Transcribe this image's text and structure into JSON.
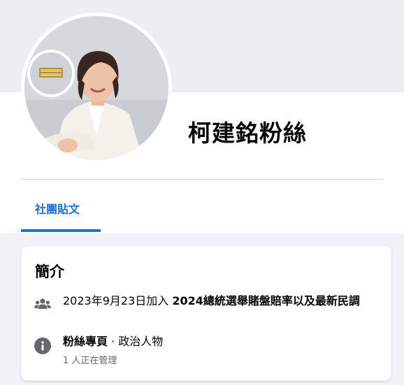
{
  "page": {
    "title": "柯建銘粉絲"
  },
  "tabs": [
    {
      "label": "社團貼文",
      "active": true
    }
  ],
  "about": {
    "heading": "簡介",
    "created_date_text": "2023年9月23日加入",
    "group_name": "2024總統選舉賭盤賠率以及最新民調",
    "page_kind": "粉絲專頁",
    "separator": " · ",
    "category": "政治人物",
    "admins_text": "1 人正在管理"
  },
  "icons": {
    "group": "people-icon",
    "info": "info-icon"
  },
  "colors": {
    "accent": "#1b74e4",
    "icon": "#65676b",
    "background": "#f0f2f5"
  }
}
